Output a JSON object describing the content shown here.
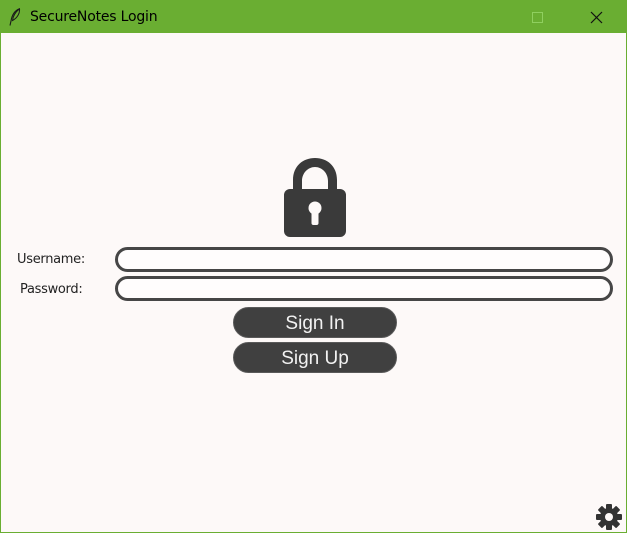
{
  "window": {
    "title": "SecureNotes Login",
    "titlebar_color": "#6aae32",
    "background_color": "#fdf9f8"
  },
  "titlebar": {
    "app_icon": "feather-icon",
    "minimize_icon": "minimize-icon",
    "maximize_icon": "maximize-icon",
    "close_icon": "close-icon"
  },
  "form": {
    "lock_icon": "lock-icon",
    "username_label": "Username:",
    "username_value": "",
    "password_label": "Password:",
    "password_value": "",
    "signin_label": "Sign In",
    "signup_label": "Sign Up",
    "button_color": "#404040"
  },
  "footer": {
    "settings_icon": "gear-icon"
  }
}
